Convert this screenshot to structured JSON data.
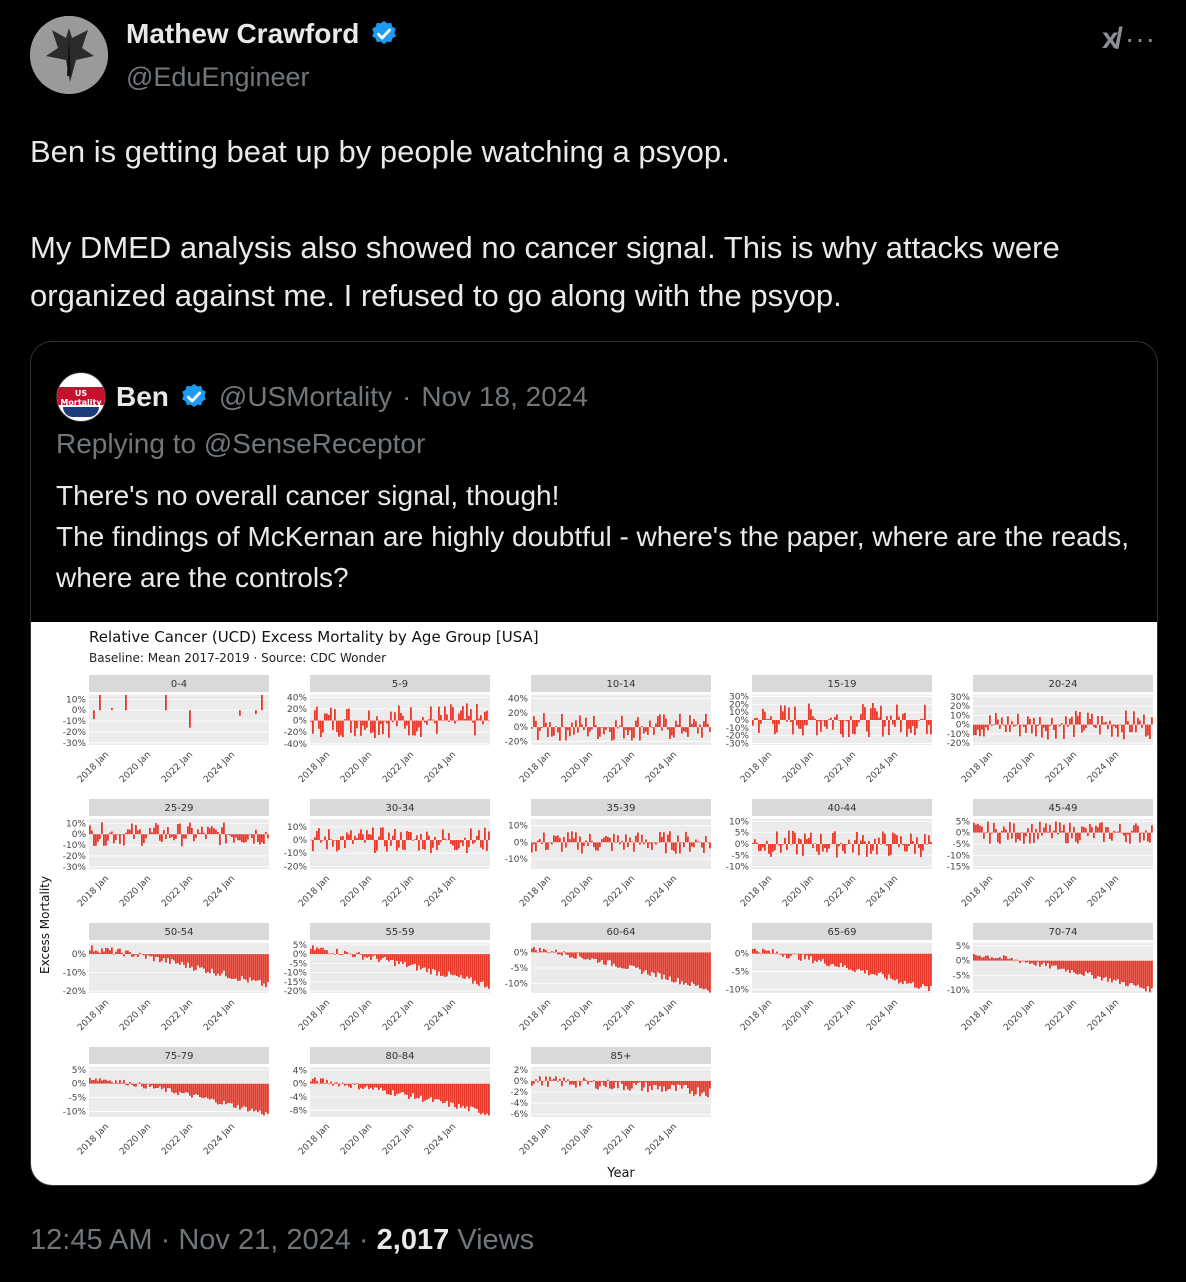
{
  "tweet": {
    "author_name": "Mathew Crawford",
    "author_handle": "@EduEngineer",
    "text": "Ben is getting beat up by people watching a psyop.\n\nMy DMED analysis also showed no cancer signal. This is why attacks were organized against me. I refused to go along with the psyop.",
    "time": "12:45 AM",
    "date": "Nov 21, 2024",
    "views_count": "2,017",
    "views_label": "Views",
    "sep": "·"
  },
  "icons": {
    "verified": "verified-badge-icon",
    "grok": "grok-icon",
    "more": "more-icon"
  },
  "quote": {
    "author_name": "Ben",
    "author_handle": "@USMortality",
    "date": "Nov 18, 2024",
    "avatar_text": "US Mortality",
    "replying_to": "Replying to @SenseReceptor",
    "text": "There's no overall cancer signal, though!\nThe findings of McKernan are highly doubtful - where's the paper, where are the reads, where are the controls?"
  },
  "colors": {
    "bar": "#e8392b",
    "verified": "#1d9bf0",
    "strip": "#d9d9d9",
    "panel": "#ebebeb"
  },
  "chart_data": {
    "type": "bar",
    "title": "Relative Cancer (UCD) Excess Mortality by Age Group [USA]",
    "subtitle": "Baseline: Mean 2017-2019 · Source: CDC Wonder",
    "xlabel": "Year",
    "ylabel": "Excess Mortality",
    "x_ticks": [
      "2018 Jan",
      "2020 Jan",
      "2022 Jan",
      "2024 Jan"
    ],
    "panels": [
      {
        "name": "0-4",
        "ylim": [
          -0.32,
          0.14
        ],
        "ticks": [
          "10%",
          "0%",
          "-10%",
          "-20%",
          "-30%"
        ],
        "tick_values": [
          0.1,
          0,
          -0.1,
          -0.2,
          -0.3
        ],
        "pattern": "sparse",
        "noise": 0.2
      },
      {
        "name": "5-9",
        "ylim": [
          -0.42,
          0.44
        ],
        "ticks": [
          "40%",
          "20%",
          "0%",
          "-20%",
          "-40%"
        ],
        "tick_values": [
          0.4,
          0.2,
          0,
          -0.2,
          -0.4
        ],
        "pattern": "noise",
        "noise": 0.3
      },
      {
        "name": "10-14",
        "ylim": [
          -0.25,
          0.45
        ],
        "ticks": [
          "40%",
          "20%",
          "0%",
          "-20%"
        ],
        "tick_values": [
          0.4,
          0.2,
          0,
          -0.2
        ],
        "pattern": "noise",
        "noise": 0.2
      },
      {
        "name": "15-19",
        "ylim": [
          -0.32,
          0.32
        ],
        "ticks": [
          "30%",
          "20%",
          "10%",
          "0%",
          "-10%",
          "-20%",
          "-30%"
        ],
        "tick_values": [
          0.3,
          0.2,
          0.1,
          0,
          -0.1,
          -0.2,
          -0.3
        ],
        "pattern": "noise",
        "noise": 0.22
      },
      {
        "name": "20-24",
        "ylim": [
          -0.22,
          0.32
        ],
        "ticks": [
          "30%",
          "20%",
          "10%",
          "0%",
          "-10%",
          "-20%"
        ],
        "tick_values": [
          0.3,
          0.2,
          0.1,
          0,
          -0.1,
          -0.2
        ],
        "pattern": "noise",
        "noise": 0.16
      },
      {
        "name": "25-29",
        "ylim": [
          -0.32,
          0.14
        ],
        "ticks": [
          "10%",
          "0%",
          "-10%",
          "-20%",
          "-30%"
        ],
        "tick_values": [
          0.1,
          0,
          -0.1,
          -0.2,
          -0.3
        ],
        "pattern": "noise",
        "noise": 0.11
      },
      {
        "name": "30-34",
        "ylim": [
          -0.22,
          0.16
        ],
        "ticks": [
          "10%",
          "0%",
          "-10%",
          "-20%"
        ],
        "tick_values": [
          0.1,
          0,
          -0.1,
          -0.2
        ],
        "pattern": "noise",
        "noise": 0.1
      },
      {
        "name": "35-39",
        "ylim": [
          -0.16,
          0.14
        ],
        "ticks": [
          "10%",
          "0%",
          "-10%"
        ],
        "tick_values": [
          0.1,
          0,
          -0.1
        ],
        "pattern": "noise",
        "noise": 0.07
      },
      {
        "name": "40-44",
        "ylim": [
          -0.11,
          0.11
        ],
        "ticks": [
          "10%",
          "5%",
          "0%",
          "-5%",
          "-10%"
        ],
        "tick_values": [
          0.1,
          0.05,
          0,
          -0.05,
          -0.1
        ],
        "pattern": "noise",
        "noise": 0.06
      },
      {
        "name": "45-49",
        "ylim": [
          -0.16,
          0.06
        ],
        "ticks": [
          "5%",
          "0%",
          "-5%",
          "-10%",
          "-15%"
        ],
        "tick_values": [
          0.05,
          0,
          -0.05,
          -0.1,
          -0.15
        ],
        "pattern": "noise",
        "noise": 0.05
      },
      {
        "name": "50-54",
        "ylim": [
          -0.21,
          0.06
        ],
        "ticks": [
          "0%",
          "-10%",
          "-20%"
        ],
        "tick_values": [
          0,
          -0.1,
          -0.2
        ],
        "pattern": "decline",
        "start": 0.03,
        "end": -0.17,
        "noise": 0.02
      },
      {
        "name": "55-59",
        "ylim": [
          -0.21,
          0.06
        ],
        "ticks": [
          "5%",
          "0%",
          "-5%",
          "-10%",
          "-15%",
          "-20%"
        ],
        "tick_values": [
          0.05,
          0,
          -0.05,
          -0.1,
          -0.15,
          -0.2
        ],
        "pattern": "decline",
        "start": 0.03,
        "end": -0.17,
        "noise": 0.02
      },
      {
        "name": "60-64",
        "ylim": [
          -0.13,
          0.03
        ],
        "ticks": [
          "0%",
          "-5%",
          "-10%"
        ],
        "tick_values": [
          0,
          -0.05,
          -0.1
        ],
        "pattern": "decline",
        "start": 0.01,
        "end": -0.12,
        "noise": 0.01
      },
      {
        "name": "65-69",
        "ylim": [
          -0.11,
          0.03
        ],
        "ticks": [
          "0%",
          "-5%",
          "-10%"
        ],
        "tick_values": [
          0,
          -0.05,
          -0.1
        ],
        "pattern": "decline",
        "start": 0.01,
        "end": -0.1,
        "noise": 0.01
      },
      {
        "name": "70-74",
        "ylim": [
          -0.11,
          0.06
        ],
        "ticks": [
          "5%",
          "0%",
          "-5%",
          "-10%"
        ],
        "tick_values": [
          0.05,
          0,
          -0.05,
          -0.1
        ],
        "pattern": "decline",
        "start": 0.02,
        "end": -0.1,
        "noise": 0.01
      },
      {
        "name": "75-79",
        "ylim": [
          -0.12,
          0.06
        ],
        "ticks": [
          "5%",
          "0%",
          "-5%",
          "-10%"
        ],
        "tick_values": [
          0.05,
          0,
          -0.05,
          -0.1
        ],
        "pattern": "decline",
        "start": 0.02,
        "end": -0.11,
        "noise": 0.01
      },
      {
        "name": "80-84",
        "ylim": [
          -0.1,
          0.05
        ],
        "ticks": [
          "4%",
          "0%",
          "-4%",
          "-8%"
        ],
        "tick_values": [
          0.04,
          0,
          -0.04,
          -0.08
        ],
        "pattern": "decline",
        "start": 0.01,
        "end": -0.09,
        "noise": 0.01
      },
      {
        "name": "85+",
        "ylim": [
          -0.065,
          0.025
        ],
        "ticks": [
          "2%",
          "0%",
          "-2%",
          "-4%",
          "-6%"
        ],
        "tick_values": [
          0.02,
          0,
          -0.02,
          -0.04,
          -0.06
        ],
        "pattern": "decline",
        "start": 0.0,
        "end": -0.02,
        "noise": 0.01
      }
    ]
  }
}
